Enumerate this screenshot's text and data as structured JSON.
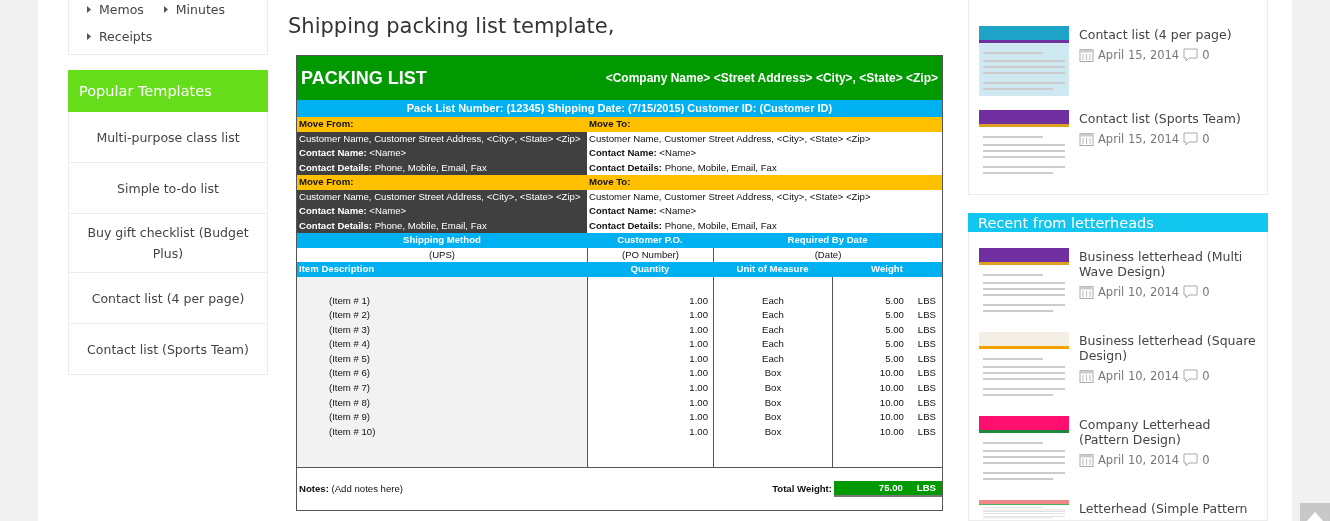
{
  "left_sidebar": {
    "categories": [
      {
        "label": "Memos"
      },
      {
        "label": "Minutes"
      },
      {
        "label": "Receipts"
      }
    ],
    "popular": {
      "title": "Popular Templates",
      "items": [
        "Multi-purpose class list",
        "Simple to-do list",
        "Buy gift checklist (Budget Plus)",
        "Contact list (4 per page)",
        "Contact list (Sports Team)"
      ]
    }
  },
  "main": {
    "title": "Shipping packing list template,",
    "sheet": {
      "title": "PACKING LIST",
      "company": "<Company Name> <Street Address> <City>, <State> <Zip>",
      "info": "Pack List Number: (12345) Shipping Date: (7/15/2015) Customer ID: (Customer ID)",
      "address_blocks": [
        {
          "from_label": "Move From:",
          "to_label": "Move To:",
          "from": [
            "Customer Name, Customer Street Address, <City>, <State> <Zip>",
            "**Contact Name:** <Name>",
            "**Contact Details:** Phone, Mobile, Email, Fax"
          ],
          "to": [
            "Customer Name, Customer Street Address, <City>, <State> <Zip>",
            "**Contact Name:** <Name>",
            "**Contact Details:** Phone, Mobile, Email, Fax"
          ]
        },
        {
          "from_label": "Move From:",
          "to_label": "Move To:",
          "from": [
            "Customer Name, Customer Street Address, <City>, <State> <Zip>",
            "**Contact Name:** <Name>",
            "**Contact Details:** Phone, Mobile, Email, Fax"
          ],
          "to": [
            "Customer Name, Customer Street Address, <City>, <State> <Zip>",
            "**Contact Name:** <Name>",
            "**Contact Details:** Phone, Mobile, Email, Fax"
          ]
        }
      ],
      "shipping": {
        "headers": [
          "Shipping Method",
          "Customer P.O.",
          "Required By Date"
        ],
        "values": [
          "(UPS)",
          "(PO Number)",
          "(Date)"
        ]
      },
      "columns": [
        "Item Description",
        "Quantity",
        "Unit of Measure",
        "Weight"
      ],
      "rows": [
        {
          "item": "(Item # 1)",
          "quantity": "1.00",
          "unit": "Each",
          "weight": "5.00",
          "weight_unit": "LBS"
        },
        {
          "item": "(Item # 2)",
          "quantity": "1.00",
          "unit": "Each",
          "weight": "5.00",
          "weight_unit": "LBS"
        },
        {
          "item": "(Item # 3)",
          "quantity": "1.00",
          "unit": "Each",
          "weight": "5.00",
          "weight_unit": "LBS"
        },
        {
          "item": "(Item # 4)",
          "quantity": "1.00",
          "unit": "Each",
          "weight": "5.00",
          "weight_unit": "LBS"
        },
        {
          "item": "(Item # 5)",
          "quantity": "1.00",
          "unit": "Each",
          "weight": "5.00",
          "weight_unit": "LBS"
        },
        {
          "item": "(Item # 6)",
          "quantity": "1.00",
          "unit": "Box",
          "weight": "10.00",
          "weight_unit": "LBS"
        },
        {
          "item": "(Item # 7)",
          "quantity": "1.00",
          "unit": "Box",
          "weight": "10.00",
          "weight_unit": "LBS"
        },
        {
          "item": "(Item # 8)",
          "quantity": "1.00",
          "unit": "Box",
          "weight": "10.00",
          "weight_unit": "LBS"
        },
        {
          "item": "(Item # 9)",
          "quantity": "1.00",
          "unit": "Box",
          "weight": "10.00",
          "weight_unit": "LBS"
        },
        {
          "item": "(Item # 10)",
          "quantity": "1.00",
          "unit": "Box",
          "weight": "10.00",
          "weight_unit": "LBS"
        }
      ],
      "notes": "**Notes:** (Add notes here)",
      "total_label": "Total Weight:",
      "total": "75.00",
      "total_unit": "LBS"
    }
  },
  "right_sidebar": {
    "posts": [
      {
        "title": "Contact list (4 per page)",
        "date": "April 15, 2014",
        "comments": "0"
      },
      {
        "title": "Contact list (Sports Team)",
        "date": "April 15, 2014",
        "comments": "0"
      }
    ],
    "letterheads": {
      "title": "Recent from letterheads",
      "posts": [
        {
          "title": "Business letterhead (Multi Wave Design)",
          "date": "April 10, 2014",
          "comments": "0"
        },
        {
          "title": "Business letterhead (Square Design)",
          "date": "April 10, 2014",
          "comments": "0"
        },
        {
          "title": "Company Letterhead (Pattern Design)",
          "date": "April 10, 2014",
          "comments": "0"
        },
        {
          "title": "Letterhead (Simple Pattern"
        }
      ]
    }
  }
}
